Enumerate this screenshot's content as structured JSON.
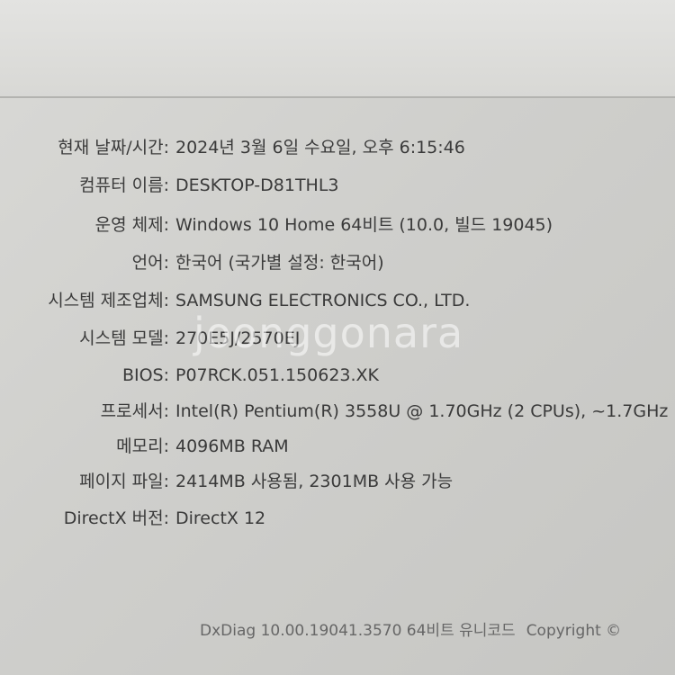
{
  "rows": [
    {
      "label": "현재 날짜/시간:",
      "value": "2024년 3월 6일 수요일, 오후 6:15:46"
    },
    {
      "label": "컴퓨터 이름:",
      "value": "DESKTOP-D81THL3"
    },
    {
      "label": "운영 체제:",
      "value": "Windows 10 Home 64비트 (10.0, 빌드 19045)"
    },
    {
      "label": "언어:",
      "value": "한국어 (국가별 설정: 한국어)"
    },
    {
      "label": "시스템 제조업체:",
      "value": "SAMSUNG ELECTRONICS CO., LTD."
    },
    {
      "label": "시스템 모델:",
      "value": "270E5J/2570EJ"
    },
    {
      "label": "BIOS:",
      "value": "P07RCK.051.150623.XK"
    },
    {
      "label": "프로세서:",
      "value": "Intel(R) Pentium(R) 3558U @ 1.70GHz (2 CPUs), ~1.7GHz"
    },
    {
      "label": "메모리:",
      "value": "4096MB RAM"
    },
    {
      "label": "페이지 파일:",
      "value": "2414MB 사용됨, 2301MB 사용 가능"
    },
    {
      "label": "DirectX 버전:",
      "value": "DirectX 12"
    }
  ],
  "footer": {
    "version": "DxDiag 10.00.19041.3570 64비트 유니코드",
    "copyright": "Copyright ©"
  },
  "watermark": "joonggonara"
}
